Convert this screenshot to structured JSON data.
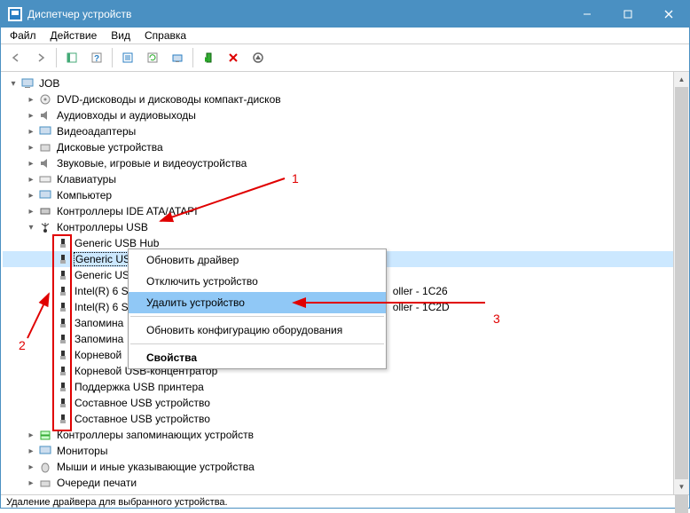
{
  "titlebar": {
    "title": "Диспетчер устройств"
  },
  "menubar": {
    "file": "Файл",
    "action": "Действие",
    "view": "Вид",
    "help": "Справка"
  },
  "status": "Удаление драйвера для выбранного устройства.",
  "context_menu": {
    "update": "Обновить драйвер",
    "disable": "Отключить устройство",
    "uninstall": "Удалить устройство",
    "scan": "Обновить конфигурацию оборудования",
    "props": "Свойства"
  },
  "annotations": {
    "n1": "1",
    "n2": "2",
    "n3": "3"
  },
  "tree": {
    "root": "JOB",
    "cat": {
      "dvd": "DVD-дисководы и дисководы компакт-дисков",
      "audio": "Аудиовходы и аудиовыходы",
      "video": "Видеоадаптеры",
      "disk": "Дисковые устройства",
      "sound": "Звуковые, игровые и видеоустройства",
      "keyboard": "Клавиатуры",
      "computer": "Компьютер",
      "ide": "Контроллеры IDE ATA/ATAPI",
      "usb": "Контроллеры USB",
      "storage": "Контроллеры запоминающих устройств",
      "monitor": "Мониторы",
      "mouse": "Мыши и иные указывающие устройства",
      "printq": "Очереди печати"
    },
    "usb": {
      "i0": "Generic USB Hub",
      "i1": "Generic US",
      "i2": "Generic US",
      "i3_a": "Intel(R) 6 S",
      "i3_b": "oller - 1C26",
      "i4_a": "Intel(R) 6 S",
      "i4_b": "oller - 1C2D",
      "i5": "Запомина",
      "i6": "Запомина",
      "i7": "Корневой",
      "i8": "Корневой USB-концентратор",
      "i9": "Поддержка USB принтера",
      "i10": "Составное USB устройство",
      "i11": "Составное USB устройство"
    }
  }
}
